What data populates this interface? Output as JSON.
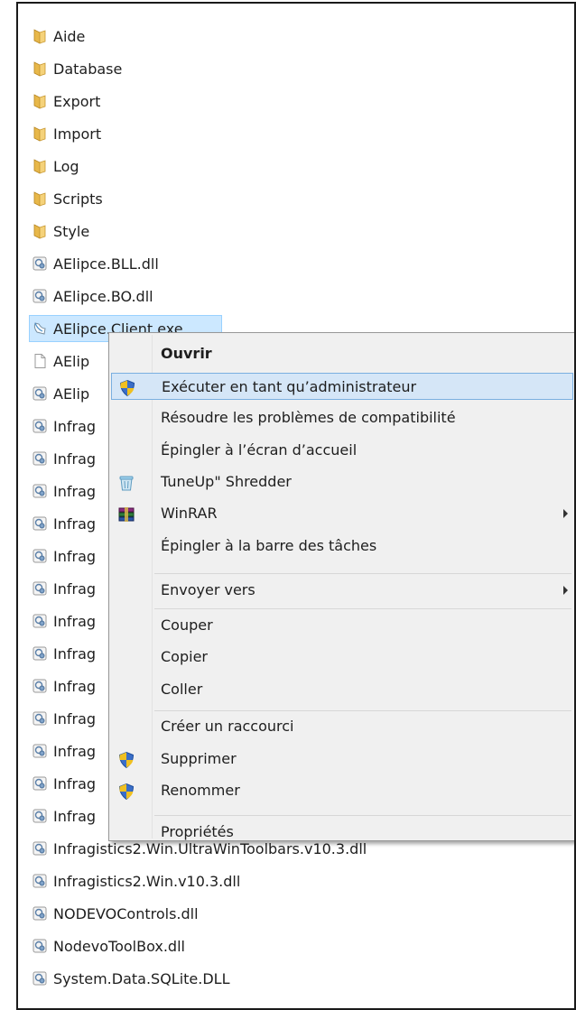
{
  "files": [
    {
      "name": "Aide",
      "icon": "folder-icon"
    },
    {
      "name": "Database",
      "icon": "folder-icon"
    },
    {
      "name": "Export",
      "icon": "folder-icon"
    },
    {
      "name": "Import",
      "icon": "folder-icon"
    },
    {
      "name": "Log",
      "icon": "folder-icon"
    },
    {
      "name": "Scripts",
      "icon": "folder-icon"
    },
    {
      "name": "Style",
      "icon": "folder-icon"
    },
    {
      "name": "AElipce.BLL.dll",
      "icon": "dll-file-icon"
    },
    {
      "name": "AElipce.BO.dll",
      "icon": "dll-file-icon"
    },
    {
      "name": "AElipce.Client.exe",
      "icon": "exe-file-icon",
      "selected": true
    },
    {
      "name": "AElip",
      "icon": "blank-file-icon"
    },
    {
      "name": "AElip",
      "icon": "dll-file-icon"
    },
    {
      "name": "Infrag",
      "icon": "dll-file-icon"
    },
    {
      "name": "Infrag",
      "icon": "dll-file-icon"
    },
    {
      "name": "Infrag",
      "icon": "dll-file-icon"
    },
    {
      "name": "Infrag",
      "icon": "dll-file-icon"
    },
    {
      "name": "Infrag",
      "icon": "dll-file-icon"
    },
    {
      "name": "Infrag",
      "icon": "dll-file-icon"
    },
    {
      "name": "Infrag",
      "icon": "dll-file-icon"
    },
    {
      "name": "Infrag",
      "icon": "dll-file-icon"
    },
    {
      "name": "Infrag",
      "icon": "dll-file-icon"
    },
    {
      "name": "Infrag",
      "icon": "dll-file-icon"
    },
    {
      "name": "Infrag",
      "icon": "dll-file-icon"
    },
    {
      "name": "Infrag",
      "icon": "dll-file-icon"
    },
    {
      "name": "Infrag",
      "icon": "dll-file-icon"
    },
    {
      "name": "Infragistics2.Win.UltraWinToolbars.v10.3.dll",
      "icon": "dll-file-icon"
    },
    {
      "name": "Infragistics2.Win.v10.3.dll",
      "icon": "dll-file-icon"
    },
    {
      "name": "NODEVOControls.dll",
      "icon": "dll-file-icon"
    },
    {
      "name": "NodevoToolBox.dll",
      "icon": "dll-file-icon"
    },
    {
      "name": "System.Data.SQLite.DLL",
      "icon": "dll-file-icon"
    }
  ],
  "context_menu": {
    "items": [
      {
        "label": "Ouvrir",
        "bold": true
      },
      {
        "label": "Exécuter en tant qu’administrateur",
        "icon": "uac-shield-icon",
        "highlighted": true
      },
      {
        "label": "Résoudre les problèmes de compatibilité"
      },
      {
        "label": "Épingler à l’écran d’accueil"
      },
      {
        "label": "TuneUp\" Shredder",
        "icon": "shredder-bin-icon"
      },
      {
        "label": "WinRAR",
        "icon": "winrar-books-icon",
        "submenu": true
      },
      {
        "label": "Épingler à la barre des tâches"
      },
      {
        "separator": true
      },
      {
        "label": "Envoyer vers",
        "submenu": true
      },
      {
        "separator": true
      },
      {
        "label": "Couper"
      },
      {
        "label": "Copier"
      },
      {
        "label": "Coller"
      },
      {
        "separator": true
      },
      {
        "label": "Créer un raccourci"
      },
      {
        "label": "Supprimer",
        "icon": "uac-shield-icon"
      },
      {
        "label": "Renommer",
        "icon": "uac-shield-icon"
      },
      {
        "separator": true
      },
      {
        "label": "Propriétés"
      }
    ]
  },
  "colors": {
    "folder": "#e8b84a",
    "selection": "#cce8ff",
    "menu_highlight": "#d5e6f7",
    "menu_background": "#f0f0f0"
  }
}
